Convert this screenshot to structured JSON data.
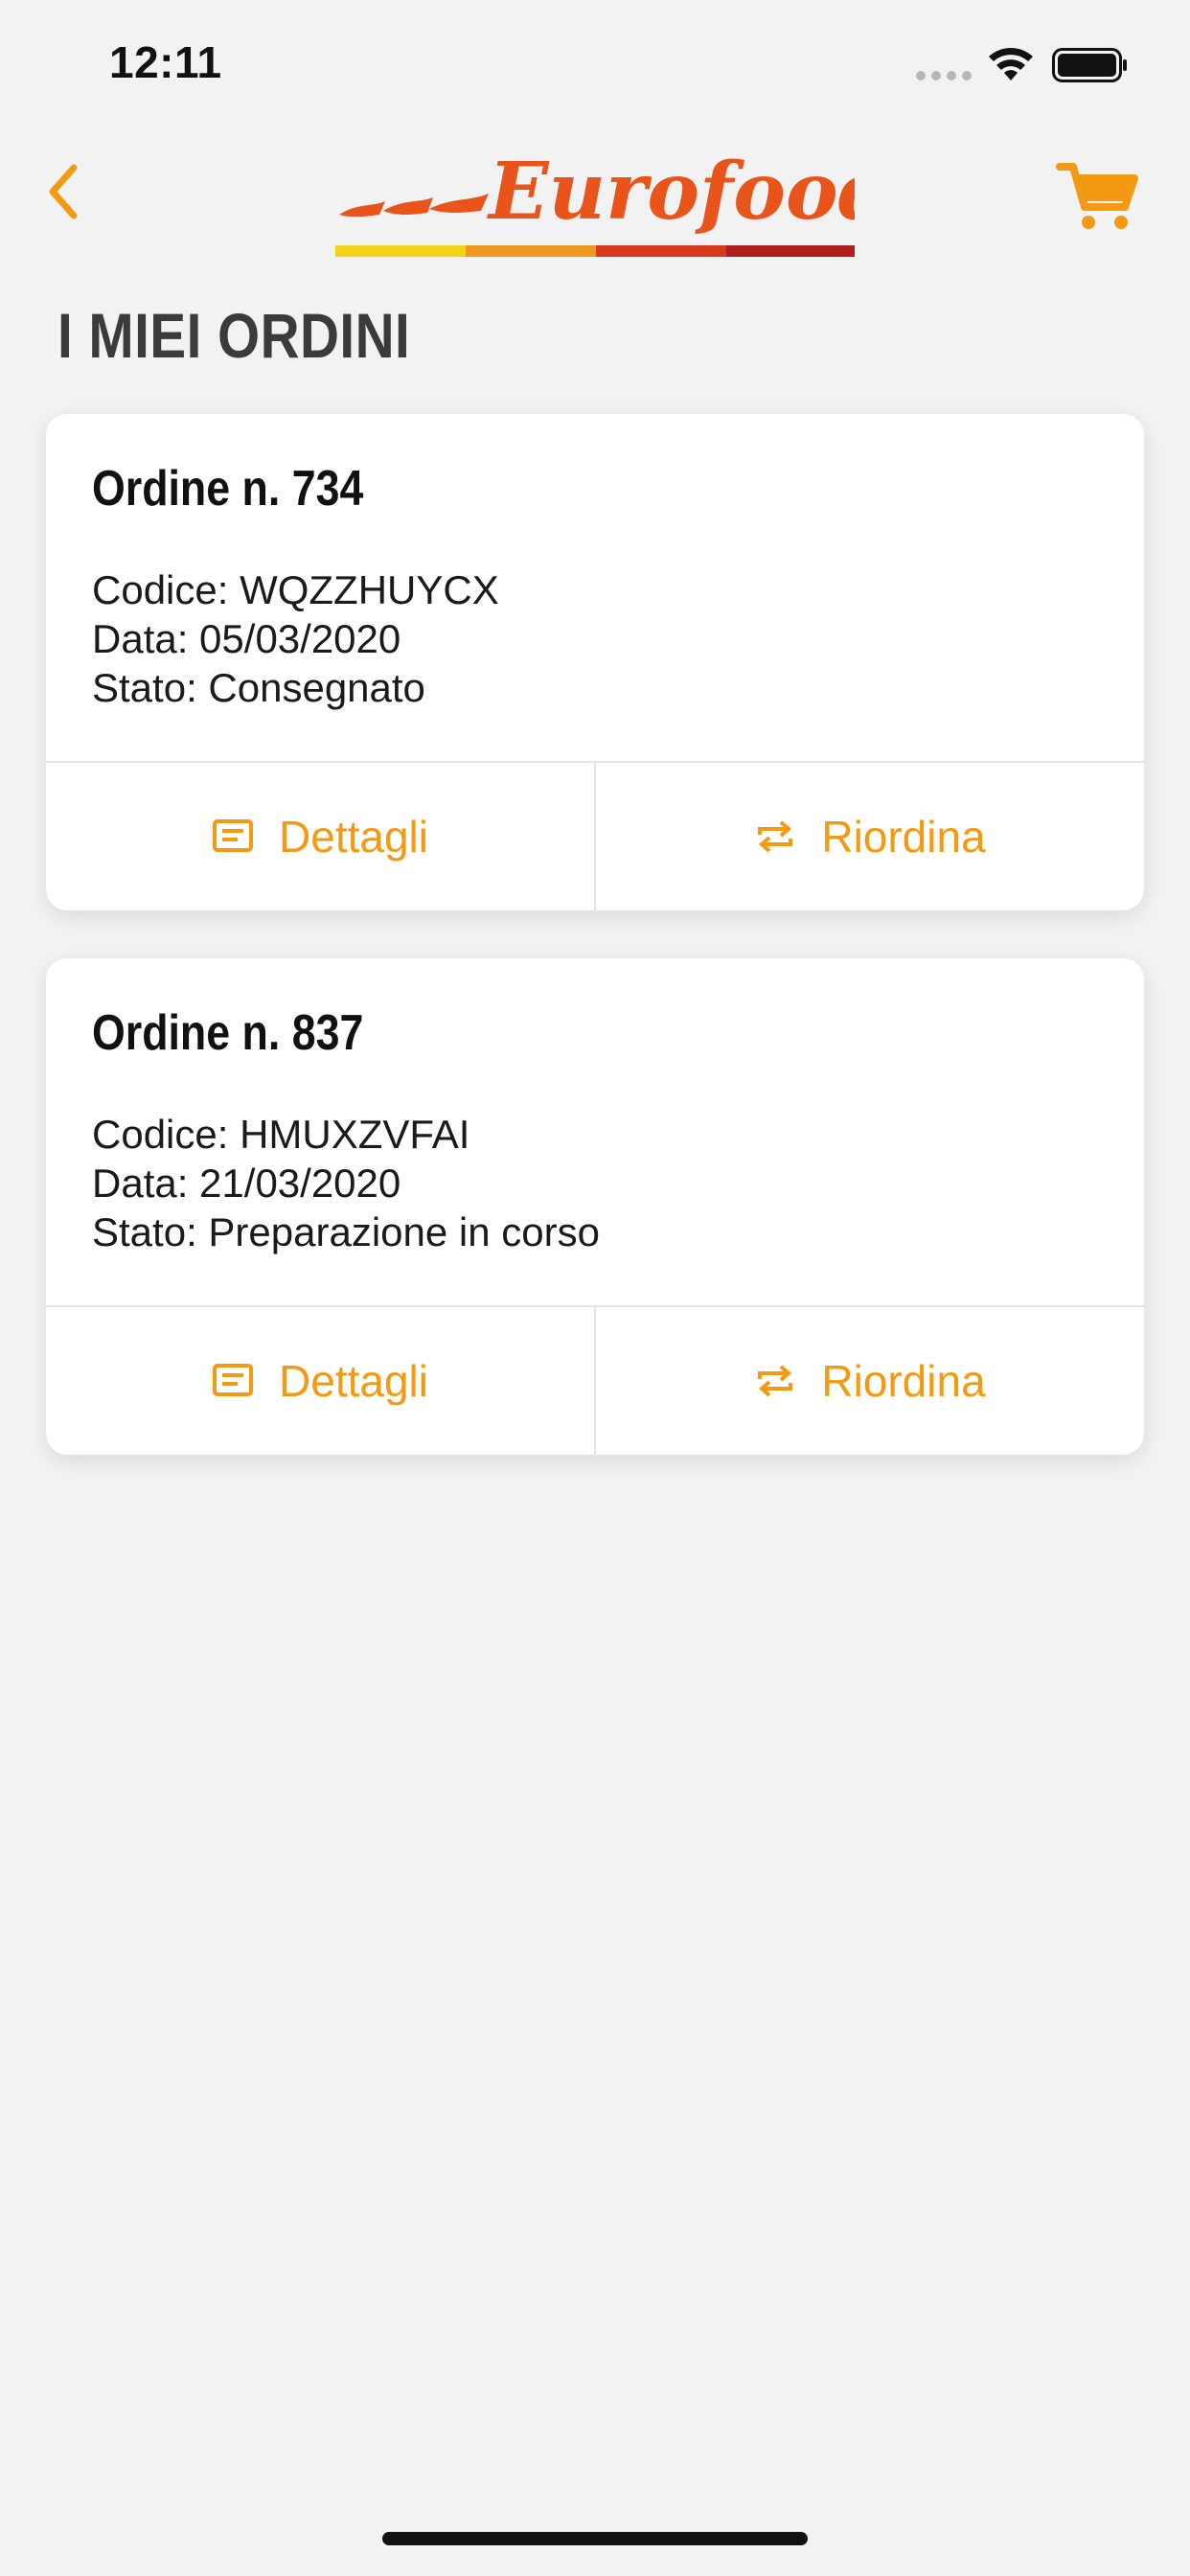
{
  "status_bar": {
    "time": "12:11"
  },
  "header": {
    "back_icon": "chevron-left-icon",
    "logo_text": "Eurofood",
    "cart_icon": "cart-icon",
    "colors": {
      "accent": "#f39a12",
      "logo": "#e8541a"
    }
  },
  "page": {
    "title": "I MIEI ORDINI"
  },
  "orders": [
    {
      "title": "Ordine n. 734",
      "code": "Codice: WQZZHUYCX",
      "date": "Data: 05/03/2020",
      "status": "Stato: Consegnato",
      "details_label": "Dettagli",
      "reorder_label": "Riordina"
    },
    {
      "title": "Ordine n. 837",
      "code": "Codice: HMUXZVFAI",
      "date": "Data: 21/03/2020",
      "status": "Stato: Preparazione in corso",
      "details_label": "Dettagli",
      "reorder_label": "Riordina"
    }
  ]
}
